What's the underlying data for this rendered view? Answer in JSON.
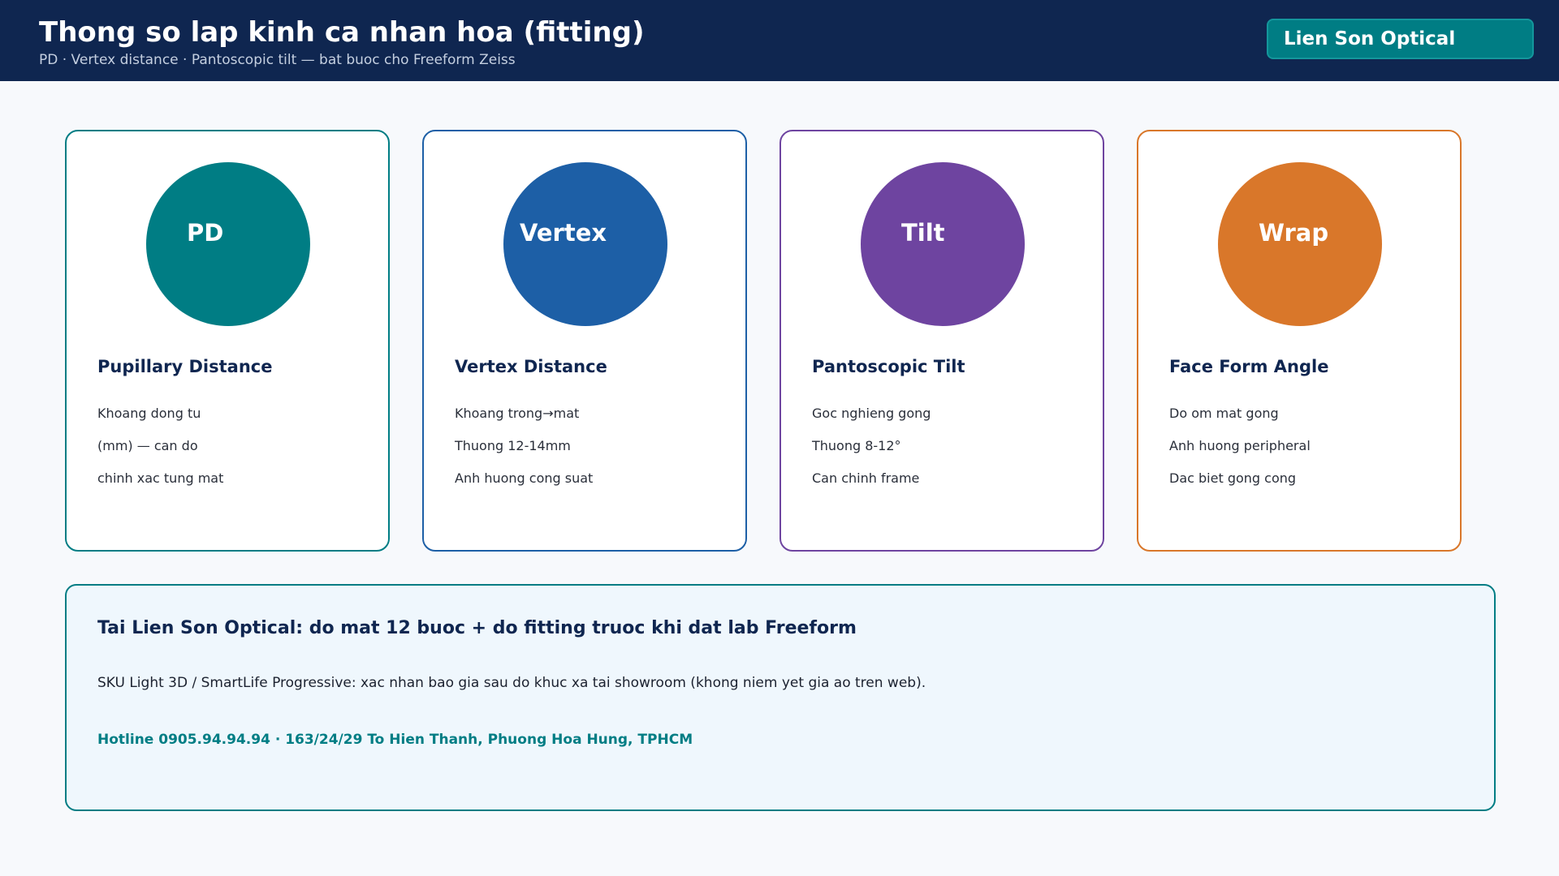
{
  "header": {
    "title": "Thong so lap kinh ca nhan hoa (fitting)",
    "subtitle": "PD · Vertex distance · Pantoscopic tilt — bat buoc cho Freeform Zeiss",
    "brand": "Lien Son Optical",
    "background_color": "#0f2650",
    "brand_color": "#007d84"
  },
  "cards": [
    {
      "circle_label": "PD",
      "title": "Pupillary Distance",
      "lines": [
        "Khoang dong tu",
        "(mm) — can do",
        "chinh xac tung mat"
      ],
      "color": "#007d84"
    },
    {
      "circle_label": "Vertex",
      "title": "Vertex Distance",
      "lines": [
        "Khoang trong→mat",
        "Thuong 12-14mm",
        "Anh huong cong suat"
      ],
      "color": "#1d5fa6"
    },
    {
      "circle_label": "Tilt",
      "title": "Pantoscopic Tilt",
      "lines": [
        "Goc nghieng gong",
        "Thuong 8-12°",
        "Can chinh frame"
      ],
      "color": "#6e44a0"
    },
    {
      "circle_label": "Wrap",
      "title": "Face Form Angle",
      "lines": [
        "Do om mat gong",
        "Anh huong peripheral",
        "Dac biet gong cong"
      ],
      "color": "#d9772a"
    }
  ],
  "info": {
    "title": "Tai Lien Son Optical: do mat 12 buoc + do fitting truoc khi dat lab Freeform",
    "text": "SKU Light 3D / SmartLife Progressive: xac nhan bao gia sau do khuc xa tai showroom (khong niem yet gia ao tren web).",
    "hotline": "Hotline 0905.94.94.94 · 163/24/29 To Hien Thanh, Phuong Hoa Hung, TPHCM"
  }
}
